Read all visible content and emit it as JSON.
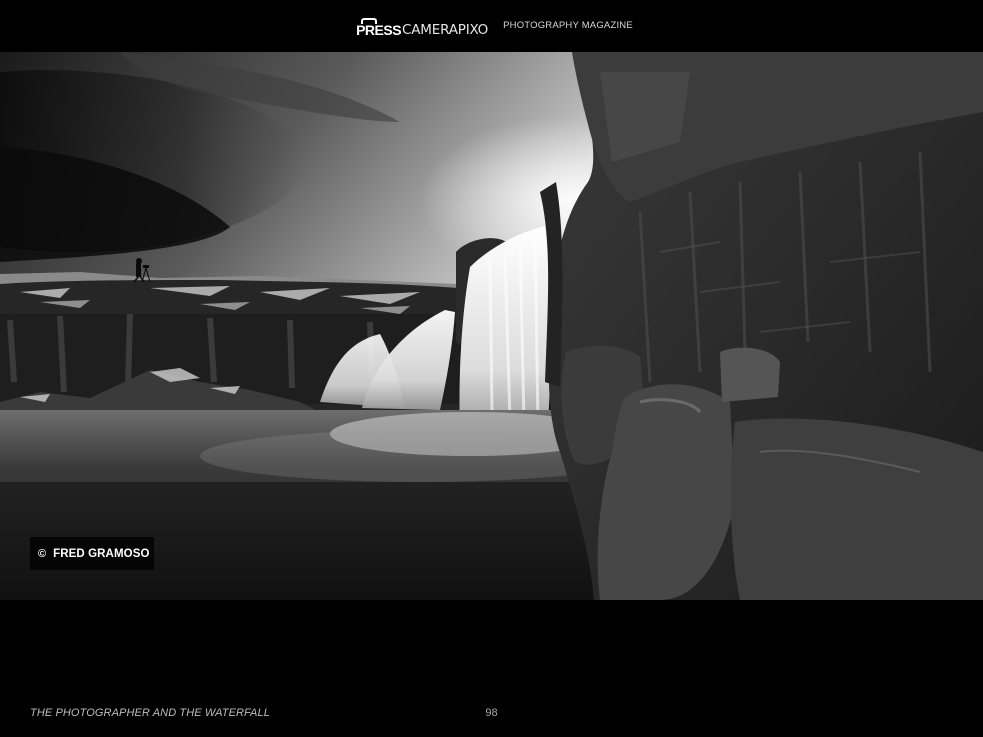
{
  "masthead": {
    "logo_press": "PRESS",
    "logo_name": "CAMERAPIXO",
    "tagline": "PHOTOGRAPHY MAGAZINE"
  },
  "photo": {
    "credit_symbol": "©",
    "credit_name": "FRED GRAMOSO"
  },
  "footer": {
    "title": "THE PHOTOGRAPHER AND THE WATERFALL",
    "page_number": "98"
  },
  "colors": {
    "background": "#000000",
    "text_primary": "#ffffff",
    "text_muted": "#bdbdbd"
  }
}
